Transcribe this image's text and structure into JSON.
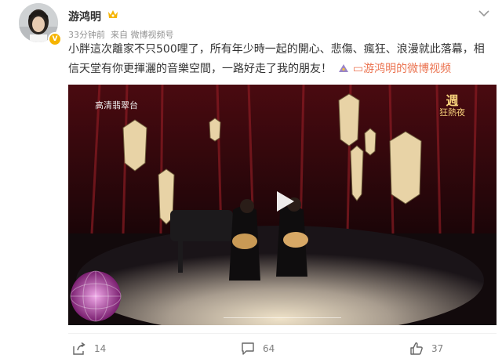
{
  "post": {
    "username": "游鸿明",
    "time": "33分钟前",
    "source_prefix": "来自",
    "source": "微博视频号",
    "text": "小胖這次離家不只500哩了，所有年少時一起的開心、悲傷、瘋狂、浪漫就此落幕，相信天堂有你更揮灑的音樂空間，一路好走了我的朋友！",
    "link_text": "游鸿明的微博视频"
  },
  "video": {
    "channel_logo": "高清翡翠台",
    "show_logo_top": "週",
    "show_logo_bottom": "狂熱夜"
  },
  "actions": {
    "share_count": "14",
    "comment_count": "64",
    "like_count": "37"
  },
  "colors": {
    "link": "#eb7350",
    "vip_badge": "#f6b400",
    "text": "#333333",
    "meta": "#939393"
  },
  "icons": [
    "crown-icon",
    "more-chevron-icon",
    "play-icon",
    "share-icon",
    "comment-icon",
    "like-icon",
    "video-link-icon"
  ]
}
